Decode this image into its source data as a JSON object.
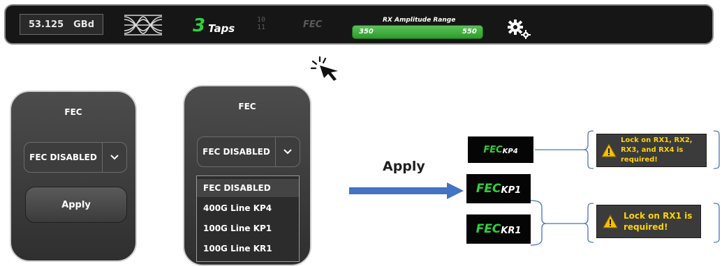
{
  "toolbar": {
    "baud_value": "53.125",
    "baud_unit": "GBd",
    "taps_value": "3",
    "taps_label": "Taps",
    "binary_icon_text": "10\n11",
    "fec_label": "FEC",
    "rx_title": "RX Amplitude Range",
    "rx_min": "350",
    "rx_max": "550",
    "icons": [
      "eye-diagram-icon",
      "binary-icon",
      "settings-gears-icon"
    ]
  },
  "panel_closed": {
    "title": "FEC",
    "selected": "FEC DISABLED",
    "apply_label": "Apply"
  },
  "panel_open": {
    "title": "FEC",
    "selected": "FEC DISABLED",
    "options": [
      "FEC DISABLED",
      "400G Line KP4",
      "100G Line KP1",
      "100G Line KR1"
    ]
  },
  "flow": {
    "apply_label": "Apply"
  },
  "badges": [
    {
      "prefix": "FEC",
      "suffix": "KP4"
    },
    {
      "prefix": "FEC",
      "suffix": "KP1"
    },
    {
      "prefix": "FEC",
      "suffix": "KR1"
    }
  ],
  "warnings": [
    {
      "text": "Lock on RX1, RX2, RX3, and RX4 is required!"
    },
    {
      "text": "Lock on RX1 is required!"
    }
  ],
  "colors": {
    "accent_green": "#2fd13a",
    "toolbar_bg": "#161616",
    "arrow_blue": "#4472c4",
    "warning_yellow": "#ffd400"
  }
}
